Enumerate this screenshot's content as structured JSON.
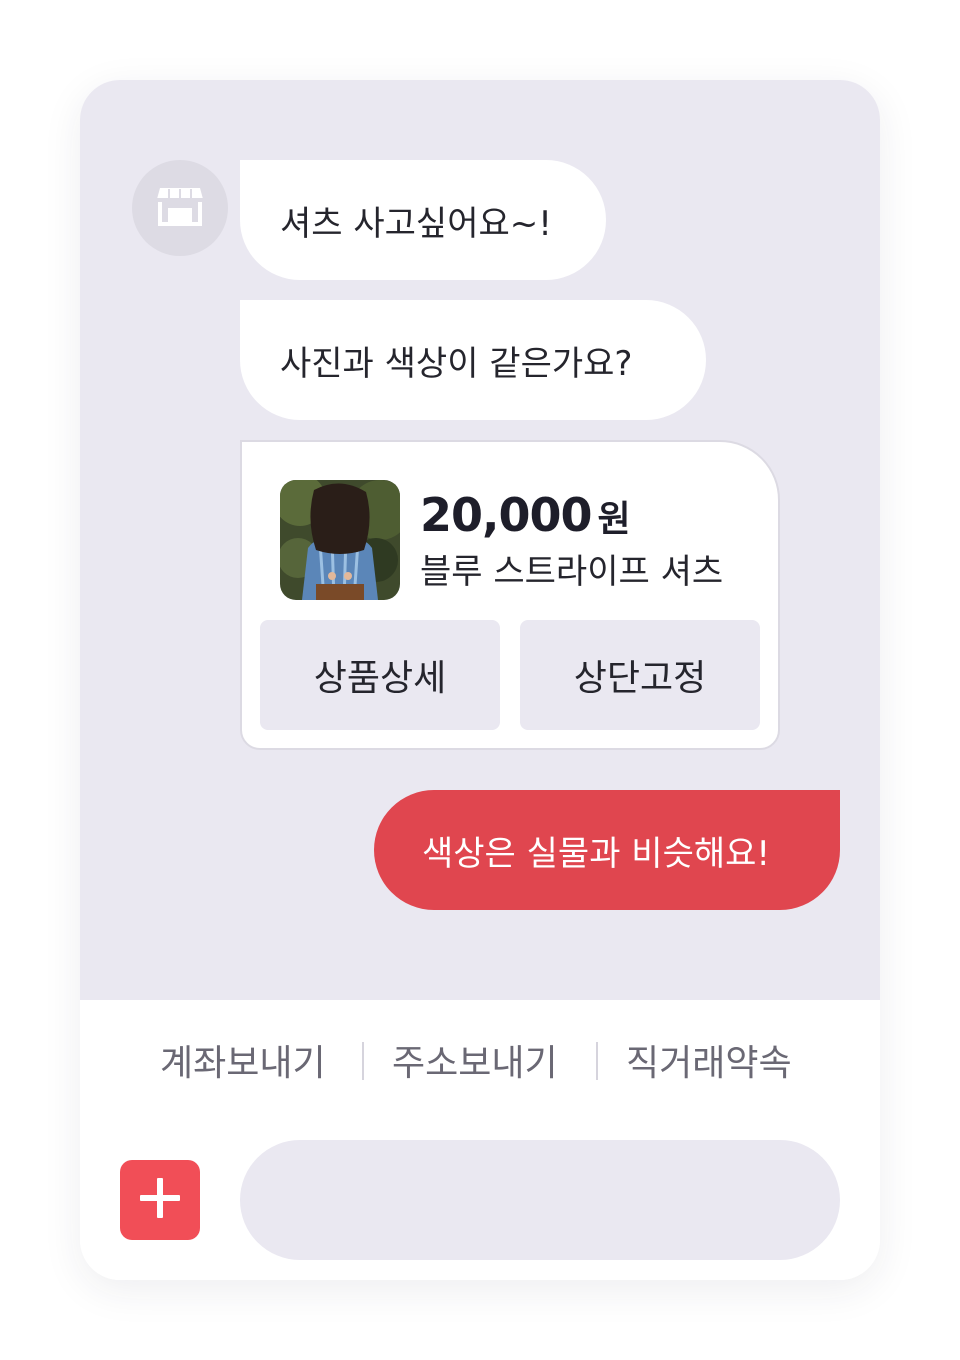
{
  "messages": {
    "incoming_1": "셔츠 사고싶어요~!",
    "incoming_2": "사진과 색상이 같은가요?",
    "outgoing_1": "색상은 실물과 비슷해요!"
  },
  "product": {
    "price": "20,000",
    "currency": "원",
    "name": "블루 스트라이프 셔츠",
    "thumbnail_icon": "shirt-photo",
    "detail_button": "상품상세",
    "pin_button": "상단고정"
  },
  "quick_actions": {
    "send_account": "계좌보내기",
    "send_address": "주소보내기",
    "meetup": "직거래약속"
  },
  "composer": {
    "placeholder": "",
    "add_icon": "plus-icon"
  },
  "avatar_icon": "store-icon",
  "colors": {
    "chat_background": "#eae8f1",
    "outgoing_bubble": "#e0464f",
    "add_button": "#f14e57"
  }
}
